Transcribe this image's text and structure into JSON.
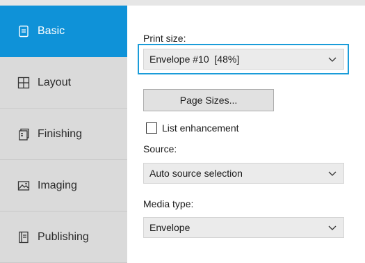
{
  "sidebar": {
    "items": [
      {
        "label": "Basic",
        "icon": "document-icon",
        "active": true
      },
      {
        "label": "Layout",
        "icon": "grid-icon",
        "active": false
      },
      {
        "label": "Finishing",
        "icon": "stapled-pages-icon",
        "active": false
      },
      {
        "label": "Imaging",
        "icon": "image-icon",
        "active": false
      },
      {
        "label": "Publishing",
        "icon": "book-icon",
        "active": false
      }
    ]
  },
  "main": {
    "print_size": {
      "label": "Print size:",
      "value": "Envelope #10  [48%]"
    },
    "page_sizes_button": "Page Sizes...",
    "list_enhancement": {
      "label": "List enhancement",
      "checked": false
    },
    "source": {
      "label": "Source:",
      "value": "Auto source selection"
    },
    "media_type": {
      "label": "Media type:",
      "value": "Envelope"
    }
  },
  "colors": {
    "accent": "#0f92d8",
    "focus": "#1a9cd9",
    "sidebar_bg": "#dadada"
  }
}
